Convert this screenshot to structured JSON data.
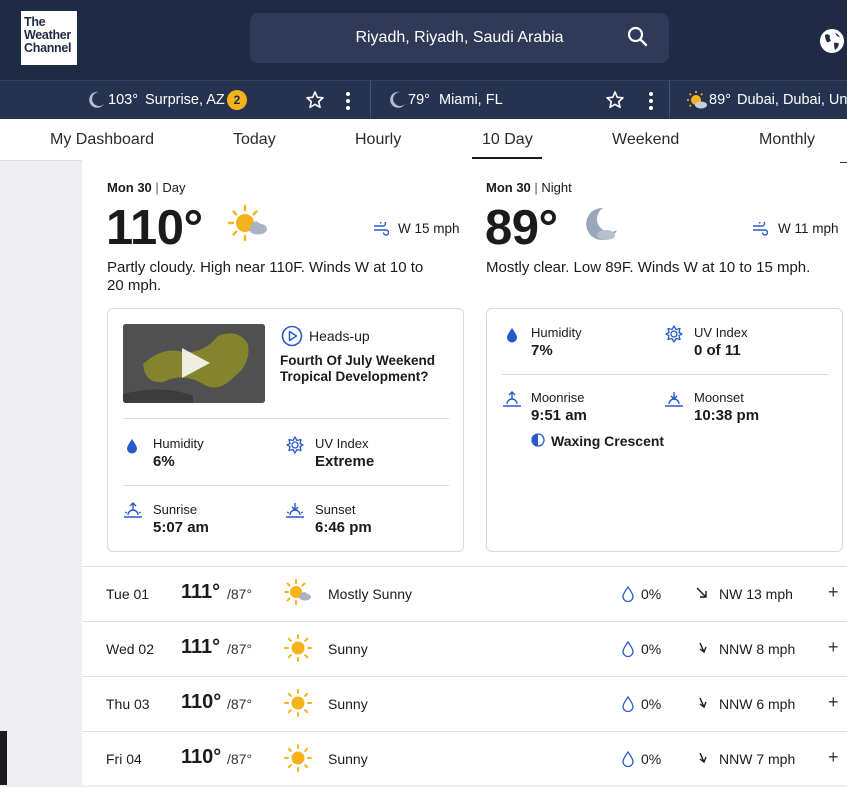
{
  "brand": {
    "logo_lines": [
      "The",
      "Weather",
      "Channel"
    ]
  },
  "search": {
    "location": "Riyadh, Riyadh, Saudi Arabia"
  },
  "recent_locations": [
    {
      "temp": "103°",
      "name": "Surprise, AZ",
      "alerts": "2",
      "icon": "moon-icon"
    },
    {
      "temp": "79°",
      "name": "Miami, FL",
      "icon": "moon-icon"
    },
    {
      "temp": "89°",
      "name": "Dubai, Dubai, Unit",
      "icon": "partly-cloudy-icon"
    }
  ],
  "nav": {
    "tabs": [
      "My Dashboard",
      "Today",
      "Hourly",
      "10 Day",
      "Weekend",
      "Monthly"
    ],
    "active": "10 Day"
  },
  "day": {
    "date": "Mon 30",
    "period": "Day",
    "temp": "110°",
    "wind": "W 15 mph",
    "narrative": "Partly cloudy. High near 110F. Winds W at 10 to 20 mph.",
    "video": {
      "tag": "Heads-up",
      "title": "Fourth Of July Weekend Tropical Development?"
    },
    "details": {
      "humidity_label": "Humidity",
      "humidity": "6%",
      "uv_label": "UV Index",
      "uv": "Extreme",
      "sunrise_label": "Sunrise",
      "sunrise": "5:07 am",
      "sunset_label": "Sunset",
      "sunset": "6:46 pm"
    }
  },
  "night": {
    "date": "Mon 30",
    "period": "Night",
    "temp": "89°",
    "wind": "W 11 mph",
    "narrative": "Mostly clear. Low 89F. Winds W at 10 to 15 mph.",
    "details": {
      "humidity_label": "Humidity",
      "humidity": "7%",
      "uv_label": "UV Index",
      "uv": "0 of 11",
      "moonrise_label": "Moonrise",
      "moonrise": "9:51 am",
      "moonset_label": "Moonset",
      "moonset": "10:38 pm",
      "moon_phase": "Waxing Crescent"
    }
  },
  "forecast": [
    {
      "day": "Tue 01",
      "hi": "111°",
      "lo": "/87°",
      "condition": "Mostly Sunny",
      "icon": "mostly-sunny-icon",
      "precip": "0%",
      "wind": "NW 13 mph",
      "expand": "+"
    },
    {
      "day": "Wed 02",
      "hi": "111°",
      "lo": "/87°",
      "condition": "Sunny",
      "icon": "sun-icon",
      "precip": "0%",
      "wind": "NNW 8 mph",
      "expand": "+"
    },
    {
      "day": "Thu 03",
      "hi": "110°",
      "lo": "/87°",
      "condition": "Sunny",
      "icon": "sun-icon",
      "precip": "0%",
      "wind": "NNW 6 mph",
      "expand": "+"
    },
    {
      "day": "Fri 04",
      "hi": "110°",
      "lo": "/87°",
      "condition": "Sunny",
      "icon": "sun-icon",
      "precip": "0%",
      "wind": "NNW 7 mph",
      "expand": "+"
    }
  ],
  "colors": {
    "header": "#1f2a45",
    "accent": "#f6b21b",
    "icon_blue": "#2a5ac9"
  }
}
